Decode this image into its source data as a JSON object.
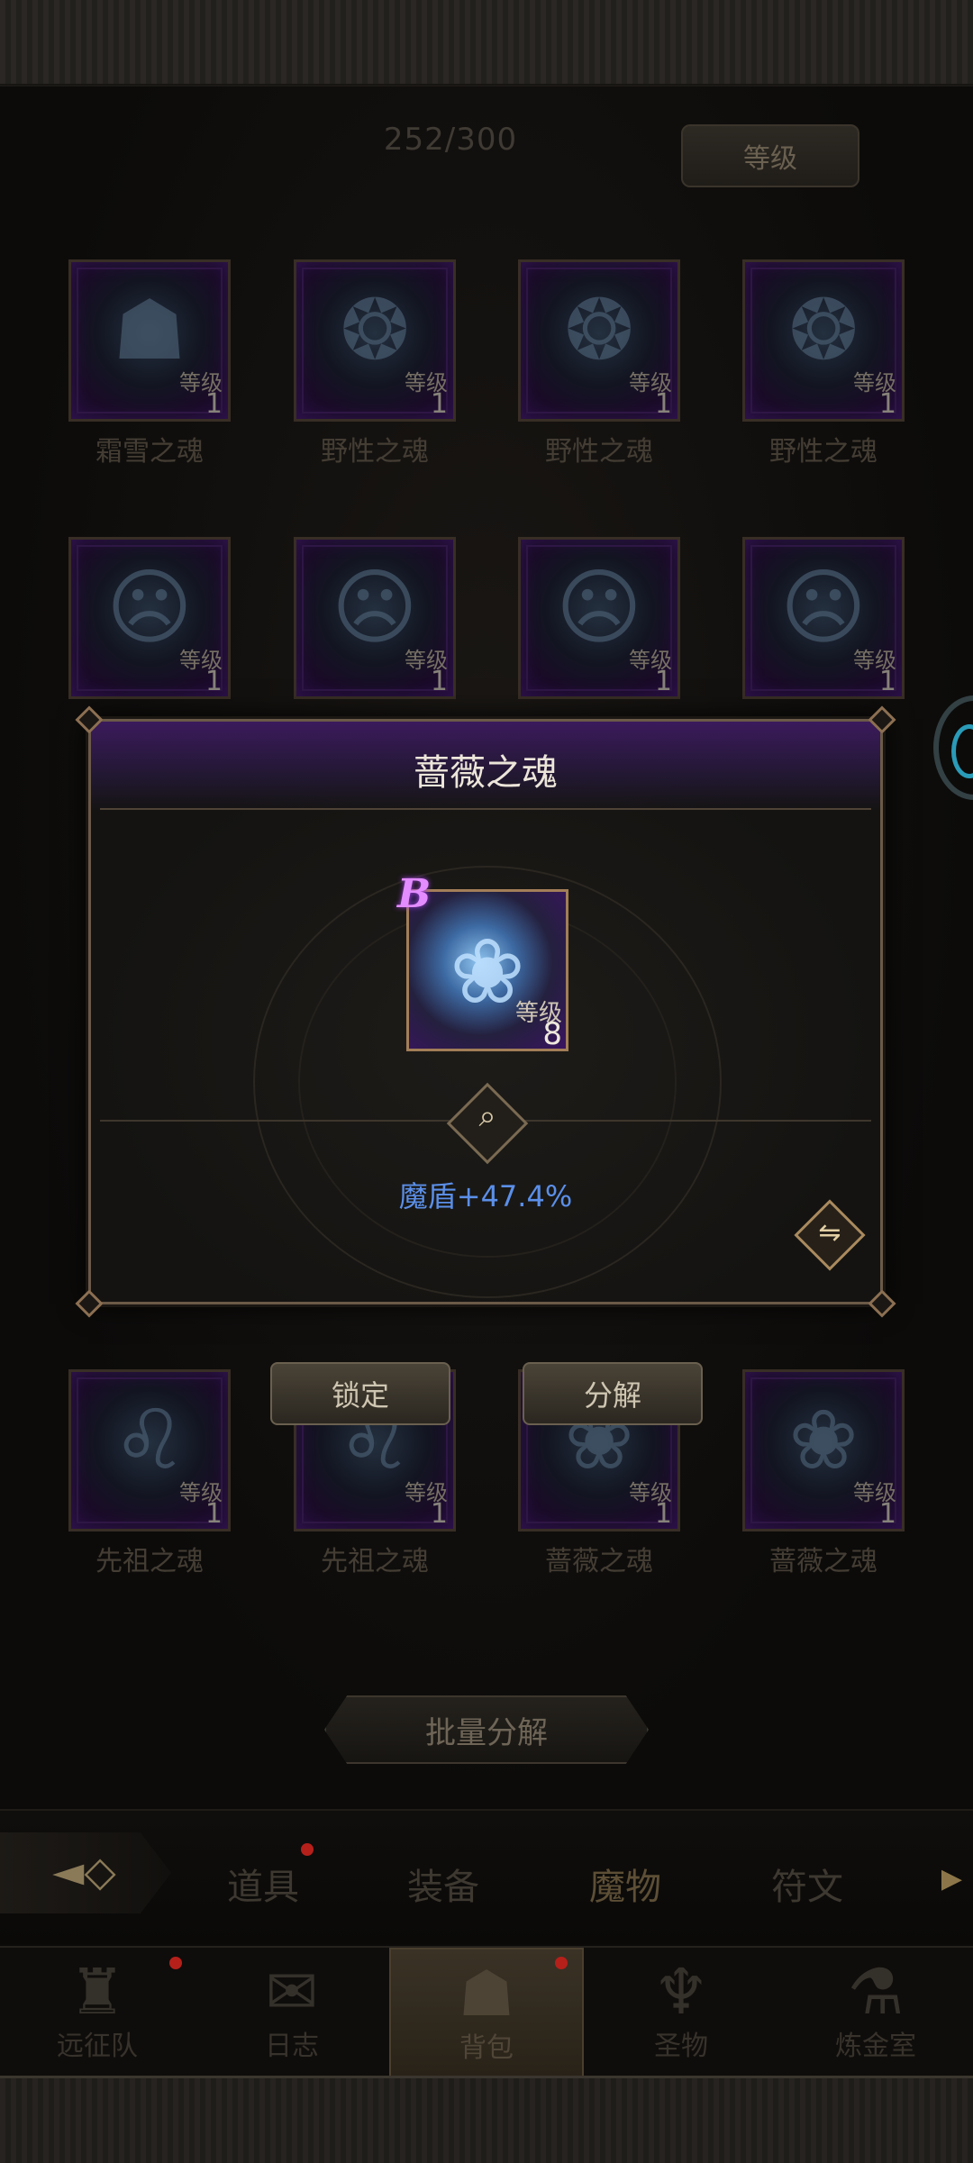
{
  "header": {
    "count": "252/300",
    "sort_label": "等级"
  },
  "card_level_label": "等级",
  "grid": {
    "row1": [
      {
        "name": "霜雪之魂",
        "level": "1",
        "icon": "mask-icon"
      },
      {
        "name": "野性之魂",
        "level": "1",
        "icon": "bear-icon"
      },
      {
        "name": "野性之魂",
        "level": "1",
        "icon": "bear-icon"
      },
      {
        "name": "野性之魂",
        "level": "1",
        "icon": "bear-icon"
      }
    ],
    "row2": [
      {
        "level": "1",
        "icon": "ghost-face-icon"
      },
      {
        "level": "1",
        "icon": "ghost-face-icon"
      },
      {
        "level": "1",
        "icon": "ghost-face-icon"
      },
      {
        "level": "1",
        "icon": "ghost-face-icon"
      }
    ],
    "row5": [
      {
        "name": "先祖之魂",
        "level": "1",
        "icon": "lion-icon"
      },
      {
        "name": "先祖之魂",
        "level": "1",
        "icon": "lion-icon"
      },
      {
        "name": "蔷薇之魂",
        "level": "1",
        "icon": "rose-icon"
      },
      {
        "name": "蔷薇之魂",
        "level": "1",
        "icon": "rose-icon"
      }
    ]
  },
  "context_buttons": {
    "lock": "锁定",
    "decompose": "分解"
  },
  "batch_button": "批量分解",
  "dialog": {
    "title": "蔷薇之魂",
    "grade": "B",
    "level_label": "等级",
    "level": "8",
    "stat": "魔盾+47.4%",
    "icon": "rose-icon"
  },
  "tabs": [
    {
      "label": "道具",
      "badge": true
    },
    {
      "label": "装备",
      "badge": false
    },
    {
      "label": "魔物",
      "badge": false,
      "active": true
    },
    {
      "label": "符文",
      "badge": false
    }
  ],
  "nav": [
    {
      "label": "远征队",
      "badge": true,
      "icon": "viking-helmet-icon"
    },
    {
      "label": "日志",
      "badge": false,
      "icon": "scroll-icon"
    },
    {
      "label": "背包",
      "badge": true,
      "active": true,
      "icon": "backpack-icon"
    },
    {
      "label": "圣物",
      "badge": false,
      "icon": "torch-icon"
    },
    {
      "label": "炼金室",
      "badge": false,
      "icon": "alchemy-icon"
    }
  ],
  "colors": {
    "accent_purple": "#4b1f7a",
    "stat_blue": "#5b8fe8",
    "badge_red": "#b5201b",
    "frame_gold": "#a27e58"
  }
}
